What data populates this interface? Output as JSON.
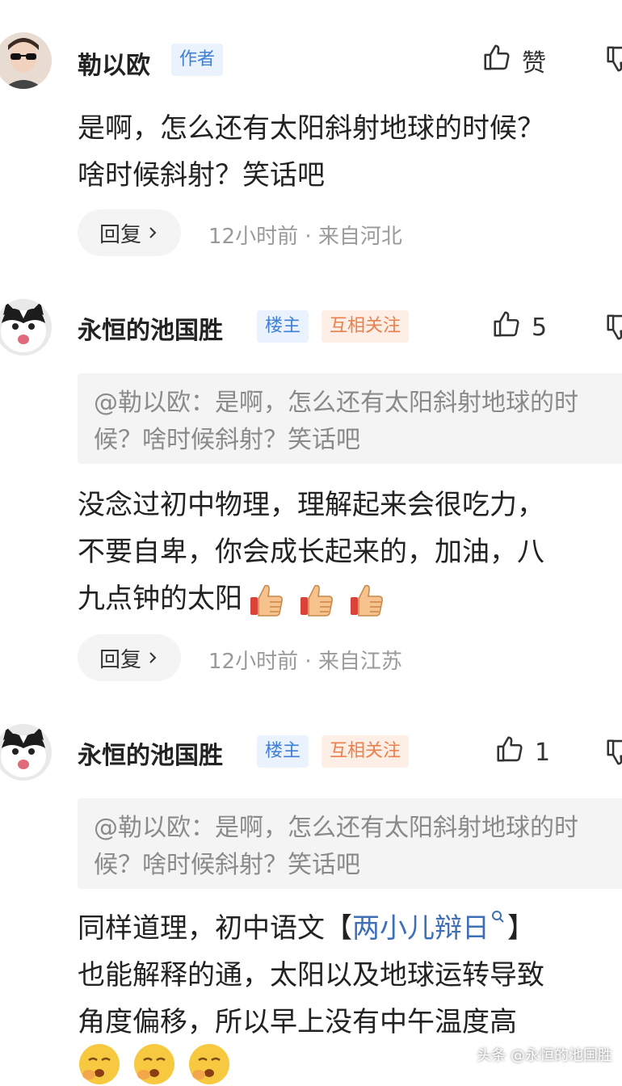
{
  "comments": [
    {
      "username": "勒以欧",
      "badges": [
        {
          "label": "作者",
          "color": "#3f7fd6"
        }
      ],
      "like_label": "赞",
      "text_lines": [
        "是啊，怎么还有太阳斜射地球的时候？",
        "啥时候斜射？笑话吧"
      ],
      "reply_label": "回复",
      "meta": "12小时前 · 来自河北"
    },
    {
      "username": "永恒的池国胜",
      "badges": [
        {
          "label": "楼主",
          "color": "#3f7fd6"
        },
        {
          "label": "互相关注",
          "color": "#e9804d"
        }
      ],
      "like_count": "5",
      "quote": "@勒以欧：是啊，怎么还有太阳斜射地球的时候？啥时候斜射？笑话吧",
      "text_lines": [
        "没念过初中物理，理解起来会很吃力，",
        "不要自卑，你会成长起来的，加油，八",
        "九点钟的太阳"
      ],
      "reply_label": "回复",
      "meta": "12小时前 · 来自江苏"
    },
    {
      "username": "永恒的池国胜",
      "badges": [
        {
          "label": "楼主",
          "color": "#3f7fd6"
        },
        {
          "label": "互相关注",
          "color": "#e9804d"
        }
      ],
      "like_count": "1",
      "quote": "@勒以欧：是啊，怎么还有太阳斜射地球的时候？啥时候斜射？笑话吧",
      "text_line1_prefix": "同样道理，初中语文【",
      "topic_link": "两小儿辩日",
      "text_line1_suffix": "】",
      "text_lines_rest": [
        "也能解释的通，太阳以及地球运转导致",
        "角度偏移，所以早上没有中午温度高"
      ]
    }
  ],
  "watermark": "头条 @永恒的池国胜",
  "icons": {
    "thumbs_up": "thumbs-up-icon",
    "thumbs_down": "thumbs-down-icon",
    "chevron": "chevron-right-icon",
    "search": "search-icon"
  },
  "colors": {
    "badge_blue": "#3f7fd6",
    "badge_orange": "#e9804d",
    "link": "#3f6fb6",
    "meta_gray": "#9a9a9a"
  }
}
